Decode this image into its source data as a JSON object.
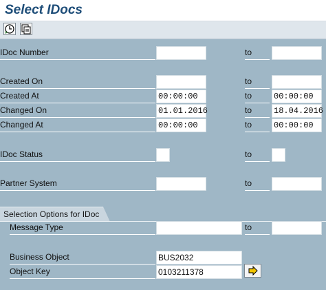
{
  "title": "Select IDocs",
  "toolbar": {
    "execute_icon": "execute-clock-icon",
    "variant_icon": "get-variant-icon"
  },
  "fields": {
    "idoc_number": {
      "label": "IDoc Number",
      "from": "",
      "to_label": "to",
      "to": ""
    },
    "created_on": {
      "label": "Created On",
      "from": "",
      "to_label": "to",
      "to": ""
    },
    "created_at": {
      "label": "Created At",
      "from": "00:00:00",
      "to_label": "to",
      "to": "00:00:00"
    },
    "changed_on": {
      "label": "Changed On",
      "from": "01.01.2016",
      "to_label": "to",
      "to": "18.04.2016"
    },
    "changed_at": {
      "label": "Changed At",
      "from": "00:00:00",
      "to_label": "to",
      "to": "00:00:00"
    },
    "idoc_status": {
      "label": "IDoc Status",
      "from": "",
      "to_label": "to",
      "to": ""
    },
    "partner_system": {
      "label": "Partner System",
      "from": "",
      "to_label": "to",
      "to": ""
    }
  },
  "section": {
    "title": "Selection Options for IDoc",
    "message_type": {
      "label": "Message Type",
      "from": "",
      "to_label": "to",
      "to": ""
    },
    "business_object": {
      "label": "Business Object",
      "value": "BUS2032"
    },
    "object_key": {
      "label": "Object Key",
      "value": "0103211378"
    }
  },
  "colors": {
    "background": "#9fb7c6",
    "title": "#1f4e79",
    "field": "#ffffff"
  }
}
